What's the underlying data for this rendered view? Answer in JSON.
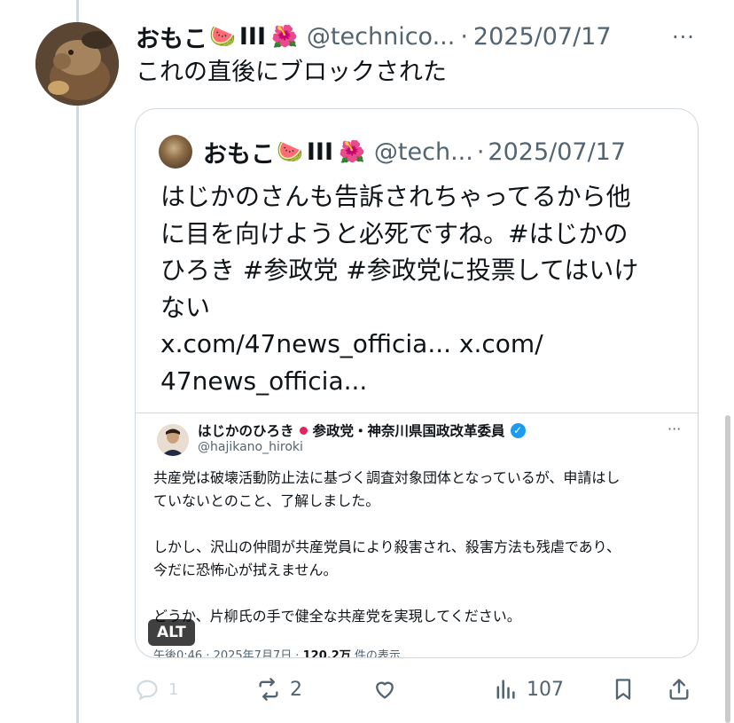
{
  "post": {
    "name": "おもこ",
    "emoji_watermelon": "🍉",
    "name_suffix": "III",
    "emoji_hibiscus": "🌺",
    "handle": "@technico...",
    "dot": "·",
    "date": "2025/07/17",
    "more": "···",
    "text": "これの直後にブロックされた"
  },
  "quote": {
    "name": "おもこ",
    "emoji_watermelon": "🍉",
    "name_suffix": "III",
    "emoji_hibiscus": "🌺",
    "handle": "@tech...",
    "dot": "·",
    "date": "2025/07/17",
    "text_lines": [
      "はじかのさんも告訴されちゃってるから他",
      "に目を向けようと必死ですね。#はじかの",
      "ひろき #参政党 #参政党に投票してはいけ",
      "ない",
      "x.com/47news_officia... x.com/",
      "47news_officia..."
    ]
  },
  "media": {
    "name": "はじかのひろき",
    "party": "参政党・神奈川県国政改革委員",
    "verified_mark": "✓",
    "handle": "@hajikano_hiroki",
    "more": "···",
    "body": {
      "line1": "共産党は破壊活動防止法に基づく調査対象団体となっているが、申請はし",
      "line2": "ていないとのこと、了解しました。",
      "line3": "しかし、沢山の仲間が共産党員により殺害され、殺害方法も残虐であり、",
      "line4": "今だに恐怖心が拭えません。",
      "line5": "どうか、片柳氏の手で健全な共産党を実現してください。"
    },
    "footer_time": "午後0:46 · 2025年7月7日 · ",
    "footer_views": "120.2万",
    "footer_suffix": " 件の表示",
    "alt_badge": "ALT"
  },
  "actions": {
    "reply_count": "1",
    "repost_count": "2",
    "views_count": "107"
  },
  "colors": {
    "secondary_text": "#536471",
    "border": "#cfd9de",
    "verified": "#1d9bf0"
  }
}
